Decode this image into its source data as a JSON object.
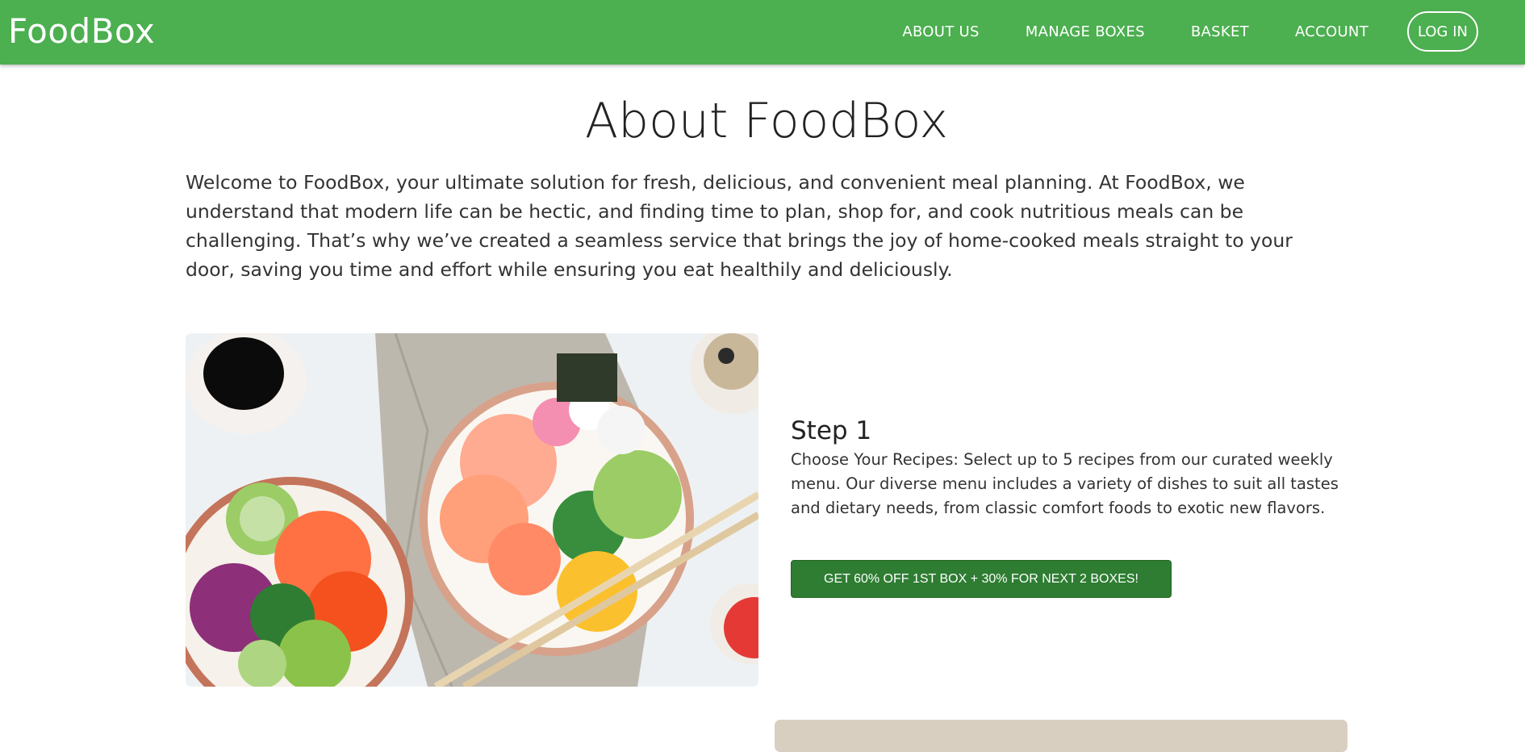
{
  "app": {
    "brand": "FoodBox"
  },
  "nav": {
    "items": [
      {
        "label": "ABOUT US"
      },
      {
        "label": "MANAGE BOXES"
      },
      {
        "label": "BASKET"
      },
      {
        "label": "ACCOUNT"
      }
    ],
    "login_label": "LOG IN"
  },
  "about": {
    "title": "About FoodBox",
    "intro": "Welcome to FoodBox, your ultimate solution for fresh, delicious, and convenient meal planning. At FoodBox, we understand that modern life can be hectic, and finding time to plan, shop for, and cook nutritious meals can be challenging. That’s why we’ve created a seamless service that brings the joy of home-cooked meals straight to your door, saving you time and effort while ensuring you eat healthily and deliciously."
  },
  "steps": [
    {
      "title": "Step 1",
      "description": "Choose Your Recipes: Select up to 5 recipes from our curated weekly menu. Our diverse menu includes a variety of dishes to suit all tastes and dietary needs, from classic comfort foods to exotic new flavors.",
      "cta_label": "GET 60% OFF 1ST BOX + 30% FOR NEXT 2 BOXES!",
      "image": "poke-bowls-photo"
    }
  ],
  "colors": {
    "primary": "#4caf50",
    "button": "#2e7d32",
    "text": "#222222"
  }
}
